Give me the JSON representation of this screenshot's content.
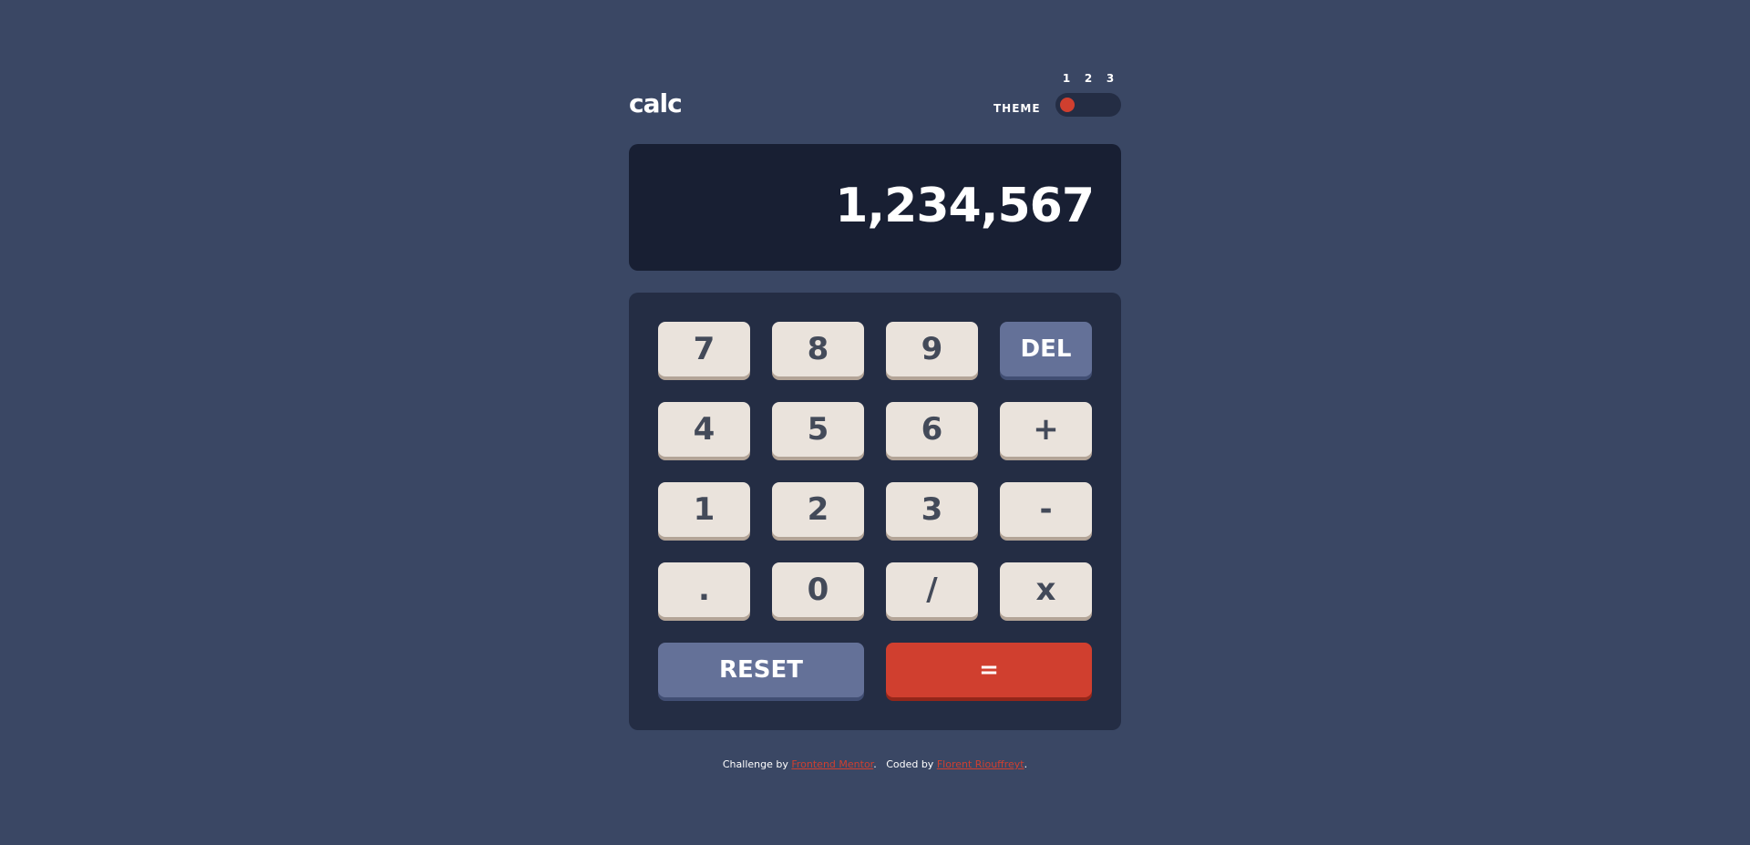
{
  "header": {
    "logo": "calc",
    "theme_label": "THEME",
    "theme_options": [
      "1",
      "2",
      "3"
    ],
    "active_theme": "1"
  },
  "screen": {
    "value": "1,234,567"
  },
  "keypad": {
    "rows": [
      [
        "7",
        "8",
        "9",
        "DEL"
      ],
      [
        "4",
        "5",
        "6",
        "+"
      ],
      [
        "1",
        "2",
        "3",
        "-"
      ],
      [
        ".",
        "0",
        "/",
        "x"
      ]
    ],
    "reset": "RESET",
    "equals": "="
  },
  "footer": {
    "challenge_prefix": "Challenge by",
    "challenge_link": "Frontend Mentor",
    "sep": ".",
    "coded_prefix": "Coded by",
    "coded_link": "Florent Riouffreyt",
    "end": "."
  },
  "colors": {
    "background": "#3a4764",
    "screen": "#181f33",
    "keypad": "#242d44",
    "key": "#eae3dc",
    "key_text": "#434a59",
    "function_key": "#647198",
    "accent": "#d03f2f"
  }
}
